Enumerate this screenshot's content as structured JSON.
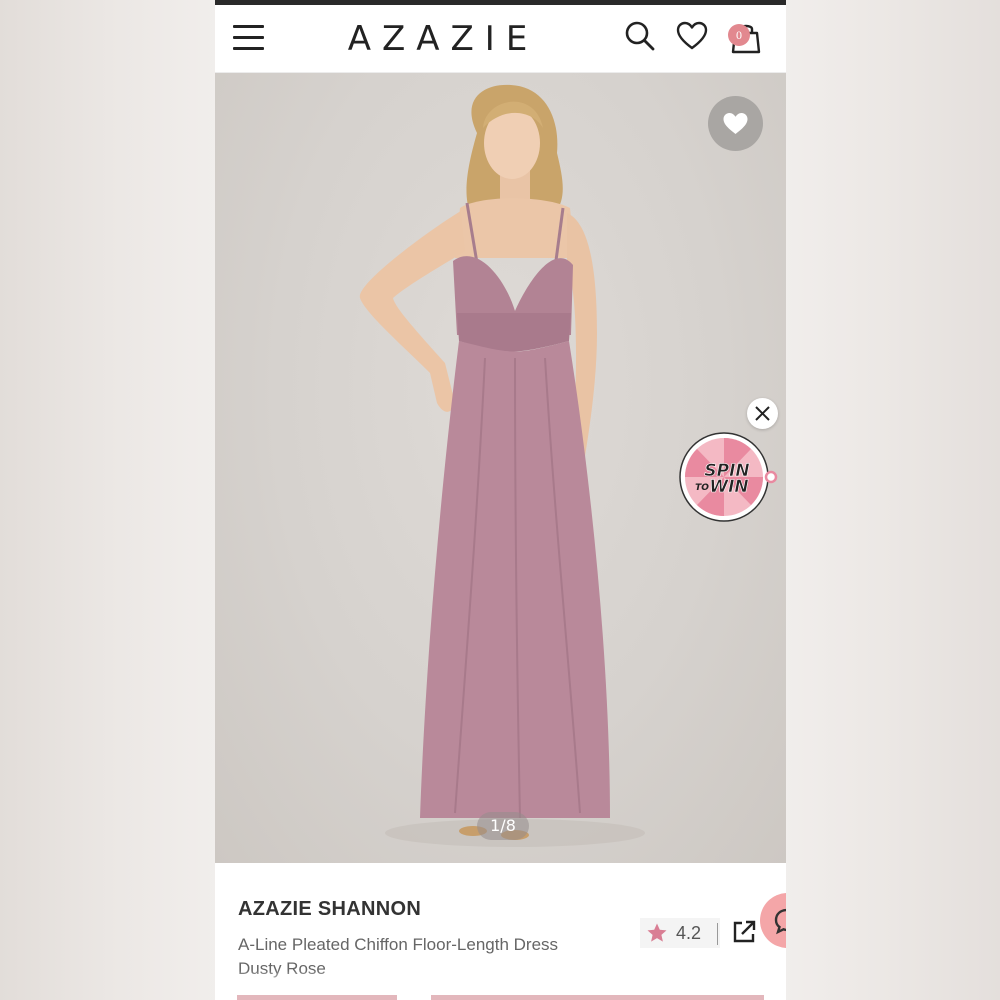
{
  "header": {
    "logo": "AZAZIE",
    "cart_count": "0",
    "icons": [
      "menu-icon",
      "search-icon",
      "heart-icon",
      "shopping-bag-icon"
    ]
  },
  "gallery": {
    "counter": "1/8",
    "promo_label_line1": "SPIN",
    "promo_label_line2": "TO",
    "promo_label_line3": "WIN"
  },
  "product": {
    "name": "AZAZIE SHANNON",
    "description_line1": "A-Line Pleated Chiffon Floor-Length Dress",
    "description_line2": "Dusty Rose",
    "rating": "4.2"
  },
  "colors": {
    "accent": "#e2888f",
    "dress": "#b8899a",
    "chat": "#f4a6a8",
    "star": "#d97e94"
  }
}
